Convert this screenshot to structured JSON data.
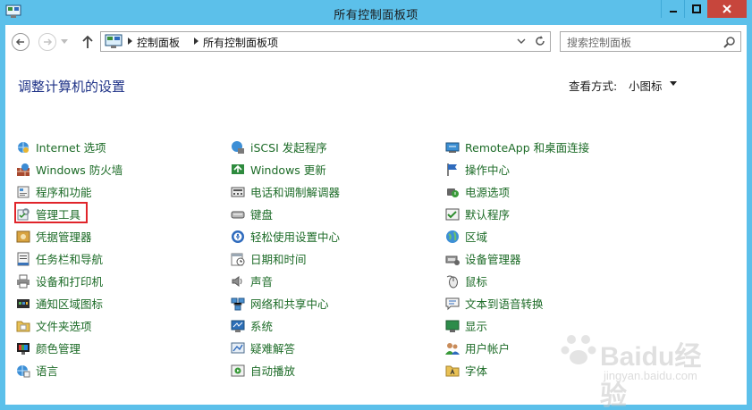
{
  "window": {
    "title": "所有控制面板项"
  },
  "address": {
    "crumbs": [
      "控制面板",
      "所有控制面板项"
    ]
  },
  "search": {
    "placeholder": "搜索控制面板"
  },
  "content": {
    "title": "调整计算机的设置",
    "view_label": "查看方式:",
    "view_value": "小图标"
  },
  "columns": [
    [
      {
        "label": "Internet 选项",
        "icon": "internet-options-icon"
      },
      {
        "label": "Windows 防火墙",
        "icon": "firewall-icon"
      },
      {
        "label": "程序和功能",
        "icon": "programs-icon"
      },
      {
        "label": "管理工具",
        "icon": "admin-tools-icon"
      },
      {
        "label": "凭据管理器",
        "icon": "credential-icon"
      },
      {
        "label": "任务栏和导航",
        "icon": "taskbar-icon"
      },
      {
        "label": "设备和打印机",
        "icon": "printer-icon"
      },
      {
        "label": "通知区域图标",
        "icon": "notification-icon"
      },
      {
        "label": "文件夹选项",
        "icon": "folder-icon"
      },
      {
        "label": "颜色管理",
        "icon": "color-icon"
      },
      {
        "label": "语言",
        "icon": "language-icon"
      }
    ],
    [
      {
        "label": "iSCSI 发起程序",
        "icon": "iscsi-icon"
      },
      {
        "label": "Windows 更新",
        "icon": "update-icon"
      },
      {
        "label": "电话和调制解调器",
        "icon": "phone-icon"
      },
      {
        "label": "键盘",
        "icon": "keyboard-icon"
      },
      {
        "label": "轻松使用设置中心",
        "icon": "accessibility-icon"
      },
      {
        "label": "日期和时间",
        "icon": "datetime-icon"
      },
      {
        "label": "声音",
        "icon": "sound-icon"
      },
      {
        "label": "网络和共享中心",
        "icon": "network-icon"
      },
      {
        "label": "系统",
        "icon": "system-icon"
      },
      {
        "label": "疑难解答",
        "icon": "troubleshoot-icon"
      },
      {
        "label": "自动播放",
        "icon": "autoplay-icon"
      }
    ],
    [
      {
        "label": "RemoteApp 和桌面连接",
        "icon": "remoteapp-icon"
      },
      {
        "label": "操作中心",
        "icon": "action-center-icon"
      },
      {
        "label": "电源选项",
        "icon": "power-icon"
      },
      {
        "label": "默认程序",
        "icon": "default-programs-icon"
      },
      {
        "label": "区域",
        "icon": "region-icon"
      },
      {
        "label": "设备管理器",
        "icon": "device-manager-icon"
      },
      {
        "label": "鼠标",
        "icon": "mouse-icon"
      },
      {
        "label": "文本到语音转换",
        "icon": "tts-icon"
      },
      {
        "label": "显示",
        "icon": "display-icon"
      },
      {
        "label": "用户帐户",
        "icon": "users-icon"
      },
      {
        "label": "字体",
        "icon": "fonts-icon"
      }
    ]
  ],
  "watermark": {
    "brand": "Baidu经验",
    "url": "jingyan.baidu.com"
  }
}
